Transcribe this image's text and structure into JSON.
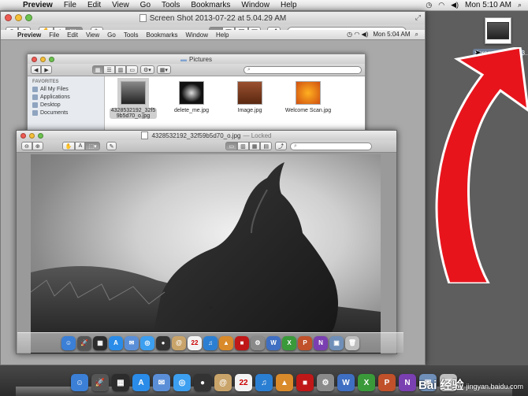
{
  "menubar": {
    "app": "Preview",
    "items": [
      "File",
      "Edit",
      "View",
      "Go",
      "Tools",
      "Bookmarks",
      "Window",
      "Help"
    ],
    "time": "Mon 5:10 AM"
  },
  "window": {
    "title": "Screen Shot 2013-07-22 at 5.04.29 AM"
  },
  "inner_menubar": {
    "app": "Preview",
    "items": [
      "File",
      "Edit",
      "View",
      "Go",
      "Tools",
      "Bookmarks",
      "Window",
      "Help"
    ],
    "time": "Mon 5:04 AM"
  },
  "finder": {
    "title": "Pictures",
    "sidebar_heading": "FAVORITES",
    "sidebar_items": [
      "All My Files",
      "Applications",
      "Desktop",
      "Documents"
    ],
    "files": [
      {
        "name": "4328532192_32f59b5d70_o.jpg",
        "color": "#3a3a3a"
      },
      {
        "name": "delete_me.jpg",
        "color": "#1a1a1a"
      },
      {
        "name": "Image.jpg",
        "color": "#7a3a20"
      },
      {
        "name": "Welcome Scan.jpg",
        "color": "#e07a10"
      }
    ]
  },
  "preview": {
    "title": "4328532192_32f59b5d70_o.jpg",
    "locked": "— Locked"
  },
  "desktop_file": {
    "label": "Screen Shot 2013…9 AM"
  },
  "dock": {
    "icons": [
      {
        "name": "finder-icon",
        "color": "#3b7fd6",
        "glyph": "☺"
      },
      {
        "name": "launchpad-icon",
        "color": "#555",
        "glyph": "🚀"
      },
      {
        "name": "mission-control-icon",
        "color": "#2c2c2c",
        "glyph": "▦"
      },
      {
        "name": "app-store-icon",
        "color": "#2a8ce8",
        "glyph": "A"
      },
      {
        "name": "mail-icon",
        "color": "#5a8fd8",
        "glyph": "✉"
      },
      {
        "name": "safari-icon",
        "color": "#3c9ff0",
        "glyph": "◎"
      },
      {
        "name": "facetime-icon",
        "color": "#333",
        "glyph": "●"
      },
      {
        "name": "contacts-icon",
        "color": "#c9a46a",
        "glyph": "@"
      },
      {
        "name": "calendar-icon",
        "color": "#f3f3f3",
        "glyph": "22"
      },
      {
        "name": "itunes-icon",
        "color": "#2b7fd3",
        "glyph": "♫"
      },
      {
        "name": "iphoto-icon",
        "color": "#d98a2a",
        "glyph": "▲"
      },
      {
        "name": "photo-booth-icon",
        "color": "#c01818",
        "glyph": "■"
      },
      {
        "name": "system-preferences-icon",
        "color": "#8a8a8a",
        "glyph": "⚙"
      },
      {
        "name": "word-icon",
        "color": "#3f6fc2",
        "glyph": "W"
      },
      {
        "name": "excel-icon",
        "color": "#3a9a3a",
        "glyph": "X"
      },
      {
        "name": "powerpoint-icon",
        "color": "#c0512a",
        "glyph": "P"
      },
      {
        "name": "onenote-icon",
        "color": "#7a3fb0",
        "glyph": "N"
      },
      {
        "name": "preview-icon",
        "color": "#6f8fb8",
        "glyph": "▣"
      },
      {
        "name": "trash-icon",
        "color": "#bdbdbd",
        "glyph": "🗑"
      }
    ]
  },
  "watermark": {
    "logo": "Bai 经验",
    "url": "jingyan.baidu.com"
  }
}
